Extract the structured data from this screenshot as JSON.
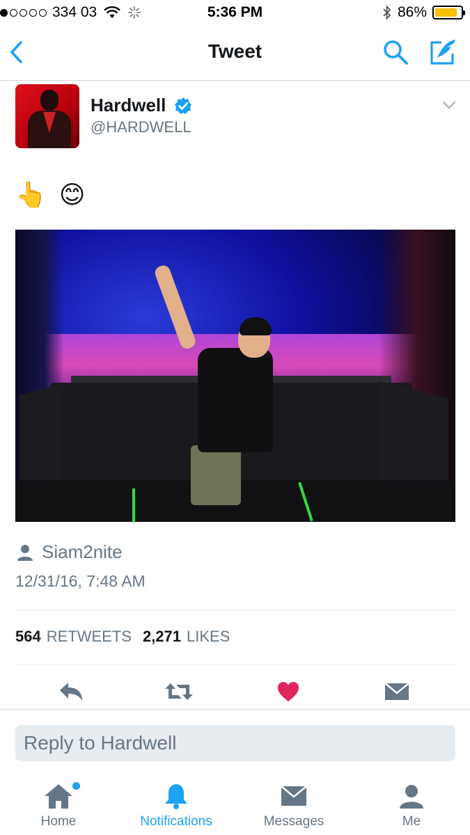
{
  "status_bar": {
    "carrier": "334 03",
    "time": "5:36 PM",
    "battery": "86%",
    "battery_level": 0.86,
    "signal_bars_filled": 1
  },
  "nav": {
    "title": "Tweet",
    "back_icon": "chevron-left-icon",
    "search_icon": "search-icon",
    "compose_icon": "compose-tweet-icon"
  },
  "tweet": {
    "display_name": "Hardwell",
    "handle": "@HARDWELL",
    "verified": true,
    "text": "👆 😊",
    "photo_alt": "photo",
    "source": "Siam2nite",
    "timestamp": "12/31/16, 7:48 AM",
    "retweets_count": "564",
    "retweets_label": "RETWEETS",
    "likes_count": "2,271",
    "likes_label": "LIKES"
  },
  "actions": {
    "reply_icon": "reply-icon",
    "retweet_icon": "retweet-icon",
    "like_icon": "heart-icon",
    "dm_icon": "direct-message-icon"
  },
  "reply_box": {
    "placeholder": "Reply to Hardwell"
  },
  "tab_bar": {
    "items": [
      {
        "label": "Home",
        "icon": "home-icon",
        "active": false,
        "has_dot": true
      },
      {
        "label": "Notifications",
        "icon": "bell-icon",
        "active": true,
        "has_dot": false
      },
      {
        "label": "Messages",
        "icon": "envelope-icon",
        "active": false,
        "has_dot": false
      },
      {
        "label": "Me",
        "icon": "person-icon",
        "active": false,
        "has_dot": false
      }
    ]
  },
  "colors": {
    "accent": "#1da1f2",
    "like": "#e0245e",
    "muted": "#657786",
    "text": "#14171a",
    "battery": "#f8c200"
  }
}
